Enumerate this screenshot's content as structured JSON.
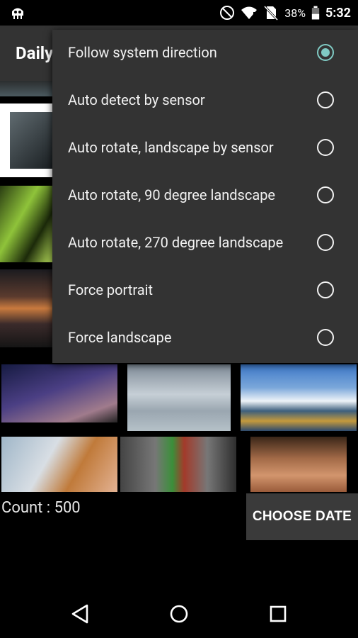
{
  "status_bar": {
    "battery_percent": "38%",
    "time": "5:32",
    "icons": [
      "android-debug-icon",
      "do-not-disturb-icon",
      "wifi-icon",
      "no-sim-icon",
      "battery-icon"
    ]
  },
  "app_bar": {
    "title": "Daily"
  },
  "orientation_menu": {
    "selected": "Follow system direction",
    "accent_color": "#80cbc4",
    "items": [
      {
        "label": "Follow system direction",
        "checked": true
      },
      {
        "label": "Auto detect by sensor",
        "checked": false
      },
      {
        "label": "Auto rotate, landscape by sensor",
        "checked": false
      },
      {
        "label": "Auto rotate, 90 degree landscape",
        "checked": false
      },
      {
        "label": "Auto rotate, 270 degree landscape",
        "checked": false
      },
      {
        "label": "Force portrait",
        "checked": false
      },
      {
        "label": "Force landscape",
        "checked": false
      }
    ]
  },
  "footer": {
    "count_text": "Count : 500",
    "choose_date_label": "CHOOSE DATE"
  },
  "nav_bar": {
    "buttons": [
      "back-icon",
      "home-icon",
      "recents-icon"
    ]
  }
}
